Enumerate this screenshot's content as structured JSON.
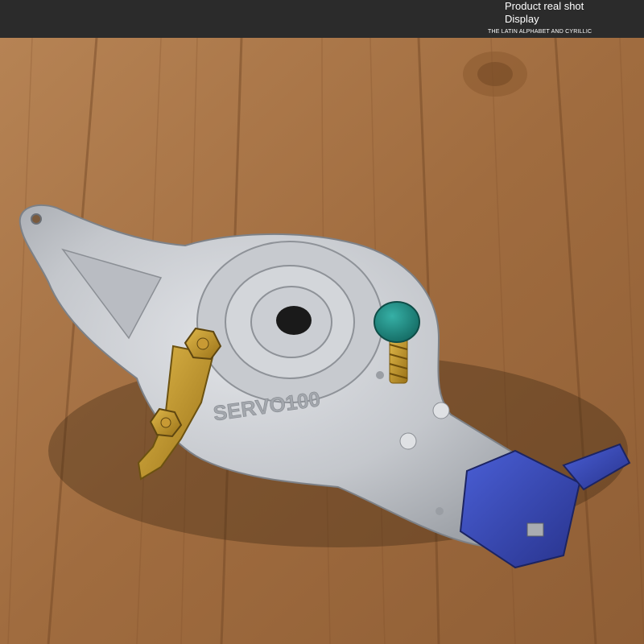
{
  "header": {
    "line1": "Product real shot",
    "line2": "Display",
    "caption": "THE LATIN ALPHABET AND CYRILLIC"
  },
  "product": {
    "embossed_text": "SERVO100"
  },
  "colors": {
    "header_bg": "#2b2b2b",
    "wood": "#a8774a",
    "metal": "#c9cbcf",
    "blue_handle": "#3444b0",
    "green_cap": "#1f8f86",
    "brass": "#c69a2a"
  }
}
